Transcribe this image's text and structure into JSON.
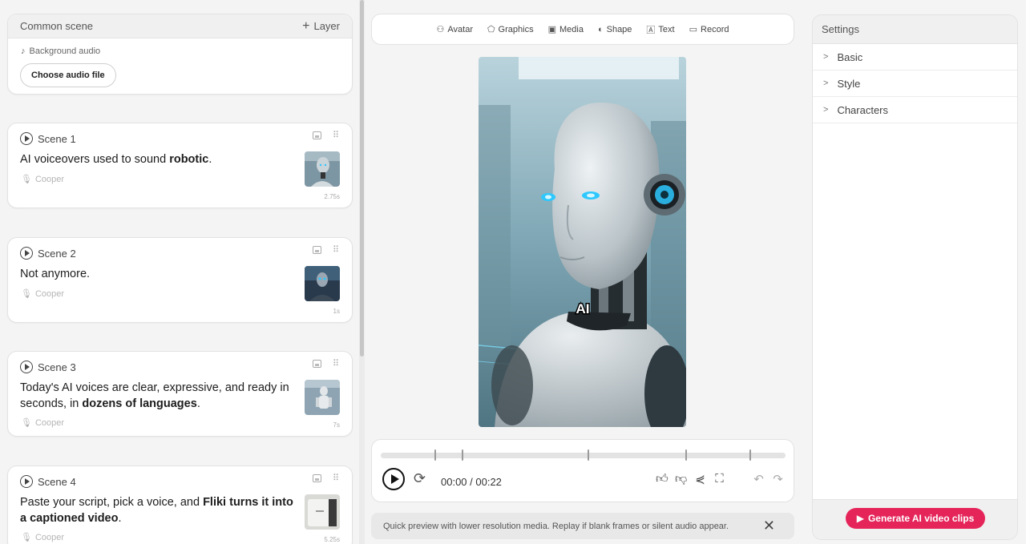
{
  "common": {
    "title": "Common scene",
    "layer_label": "Layer",
    "bg_audio_label": "Background audio",
    "choose_audio": "Choose audio file"
  },
  "scenes": [
    {
      "title": "Scene 1",
      "text_plain": "AI voiceovers used to sound ",
      "text_bold": "robotic",
      "text_tail": ".",
      "voice": "Cooper",
      "duration": "2.75s"
    },
    {
      "title": "Scene 2",
      "text_plain": "Not anymore.",
      "text_bold": "",
      "text_tail": "",
      "voice": "Cooper",
      "duration": "1s"
    },
    {
      "title": "Scene 3",
      "text_plain": "Today's AI voices are clear, expressive, and ready in seconds, in ",
      "text_bold": "dozens of languages",
      "text_tail": ".",
      "voice": "Cooper",
      "duration": "7s"
    },
    {
      "title": "Scene 4",
      "text_plain": "Paste your script, pick a voice, and ",
      "text_bold": "Fliki turns it into a captioned video",
      "text_tail": ".",
      "voice": "Cooper",
      "duration": "5.25s"
    }
  ],
  "toolbar": {
    "avatar": "Avatar",
    "graphics": "Graphics",
    "media": "Media",
    "shape": "Shape",
    "text": "Text",
    "record": "Record"
  },
  "preview": {
    "caption": "AI"
  },
  "player": {
    "time": "00:00 / 00:22",
    "progress": 0
  },
  "notice": {
    "text": "Quick preview with lower resolution media. Replay if blank frames or silent audio appear."
  },
  "settings": {
    "title": "Settings",
    "sections": [
      "Basic",
      "Style",
      "Characters"
    ],
    "generate": "Generate AI video clips"
  },
  "colors": {
    "accent": "#e5255a",
    "glow": "#2ec8ff"
  }
}
